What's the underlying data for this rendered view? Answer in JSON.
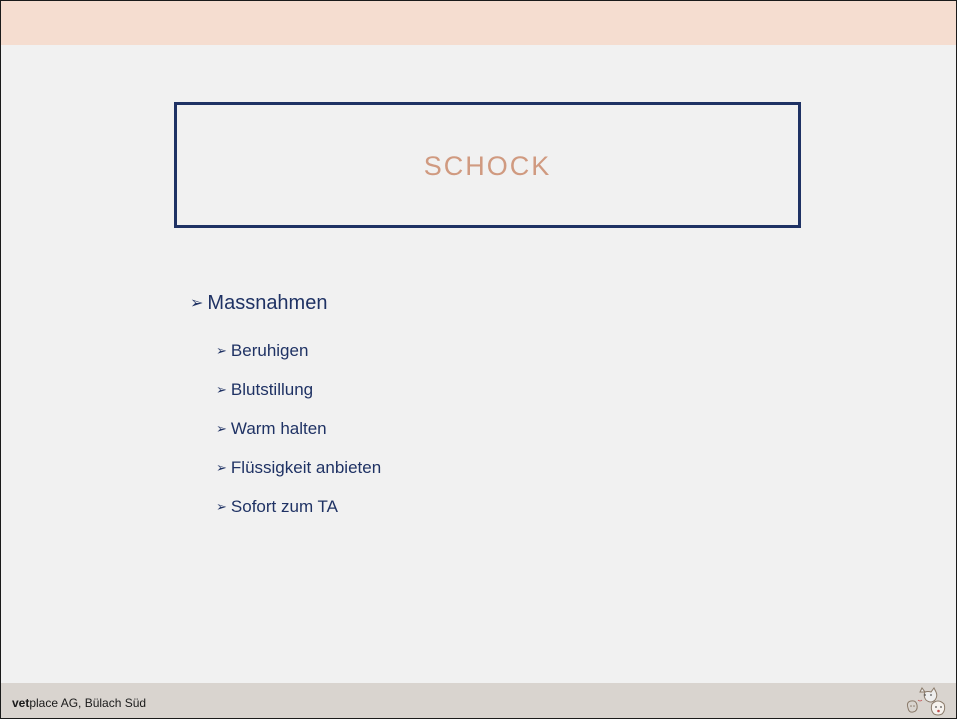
{
  "slide": {
    "title": "SCHOCK",
    "bullet_heading": "Massnahmen",
    "items": [
      "Beruhigen",
      "Blutstillung",
      "Warm halten",
      "Flüssigkeit anbieten",
      "Sofort zum TA"
    ]
  },
  "footer": {
    "brand_bold": "vet",
    "brand_rest": "place AG, Bülach Süd"
  },
  "icons": {
    "bullet": "arrowhead-bullet-icon",
    "logo": "pets-logo-icon"
  },
  "colors": {
    "top_band": "#f5ddd0",
    "background": "#f1f1f1",
    "title_border": "#1f3264",
    "title_text": "#d09a80",
    "body_text": "#1f3264",
    "footer_band": "#d9d4cf"
  }
}
